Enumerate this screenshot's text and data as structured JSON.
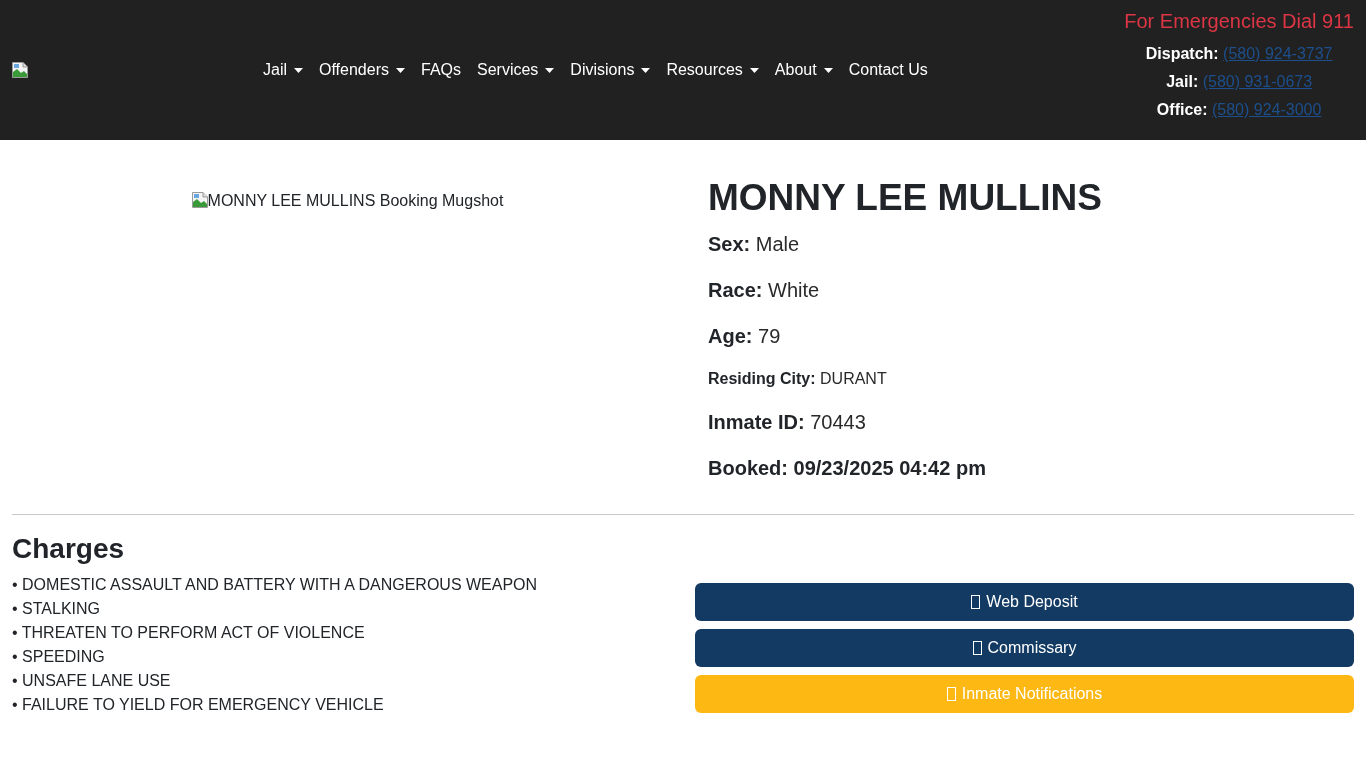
{
  "header": {
    "nav": [
      {
        "label": "Jail",
        "dropdown": true
      },
      {
        "label": "Offenders",
        "dropdown": true
      },
      {
        "label": "FAQs",
        "dropdown": false
      },
      {
        "label": "Services",
        "dropdown": true
      },
      {
        "label": "Divisions",
        "dropdown": true
      },
      {
        "label": "Resources",
        "dropdown": true
      },
      {
        "label": "About",
        "dropdown": true
      },
      {
        "label": "Contact Us",
        "dropdown": false
      }
    ],
    "emergency": "For Emergencies Dial 911",
    "contacts": [
      {
        "label": "Dispatch:",
        "phone": "(580) 924-3737"
      },
      {
        "label": "Jail:",
        "phone": "(580) 931-0673"
      },
      {
        "label": "Office:",
        "phone": "(580) 924-3000"
      }
    ]
  },
  "inmate": {
    "photo_alt": "MONNY LEE MULLINS Booking Mugshot",
    "name": "MONNY LEE MULLINS",
    "fields": [
      {
        "kind": "large",
        "label": "Sex:",
        "value": "Male"
      },
      {
        "kind": "large",
        "label": "Race:",
        "value": "White"
      },
      {
        "kind": "large",
        "label": "Age:",
        "value": "79"
      },
      {
        "kind": "small",
        "label": "Residing City:",
        "value": "DURANT"
      },
      {
        "kind": "large",
        "label": "Inmate ID:",
        "value": "70443"
      },
      {
        "kind": "strong",
        "label": "Booked:",
        "value": "09/23/2025 04:42 pm"
      }
    ]
  },
  "charges": {
    "title": "Charges",
    "items": [
      "• DOMESTIC ASSAULT AND BATTERY WITH A DANGEROUS WEAPON",
      "• STALKING",
      "• THREATEN TO PERFORM ACT OF VIOLENCE",
      "• SPEEDING",
      "• UNSAFE LANE USE",
      "• FAILURE TO YIELD FOR EMERGENCY VEHICLE"
    ]
  },
  "actions": [
    {
      "label": "Web Deposit",
      "kind": "primary"
    },
    {
      "label": "Commissary",
      "kind": "primary"
    },
    {
      "label": "Inmate Notifications",
      "kind": "warning"
    }
  ]
}
